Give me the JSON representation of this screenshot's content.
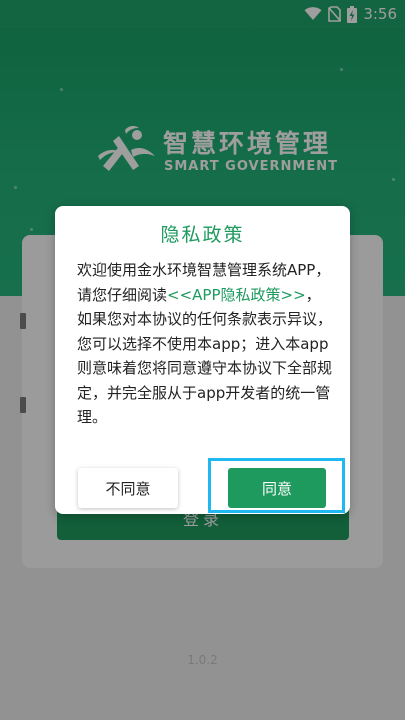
{
  "status_bar": {
    "time": "3:56"
  },
  "brand": {
    "name": "智慧环境管理",
    "subtitle": "SMART GOVERNMENT"
  },
  "login": {
    "button_label": "登录"
  },
  "version": "1.0.2",
  "dialog": {
    "title": "隐私政策",
    "body_before": "欢迎使用金水环境智慧管理系统APP，请您仔细阅读",
    "link": "<<APP隐私政策>>",
    "body_after": "，如果您对本协议的任何条款表示异议，您可以选择不使用本app；进入本app则意味着您将同意遵守本协议下全部规定，并完全服从于app开发者的统一管理。",
    "disagree_label": "不同意",
    "agree_label": "同意"
  },
  "colors": {
    "brand_green": "#1e9a5e",
    "highlight": "#1fb8f0"
  }
}
